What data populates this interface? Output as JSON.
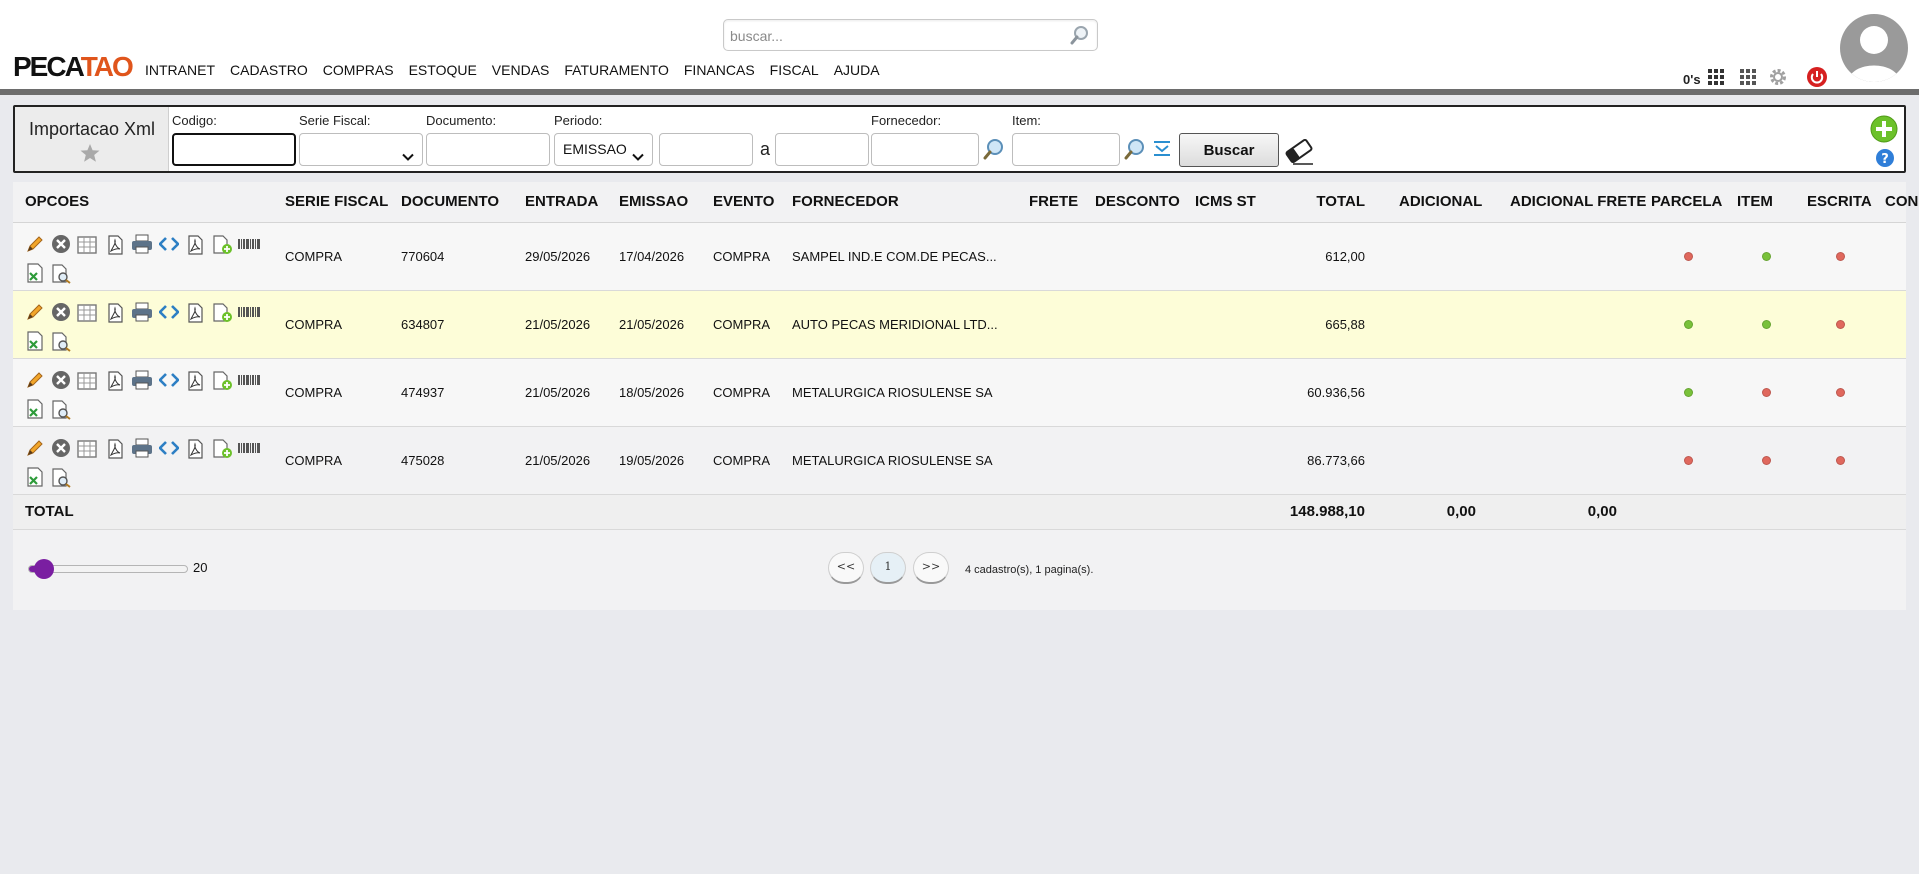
{
  "header": {
    "search_placeholder": "buscar...",
    "logo": {
      "part1": "PECA",
      "part2": "TAO"
    },
    "nav": [
      "INTRANET",
      "CADASTRO",
      "COMPRAS",
      "ESTOQUE",
      "VENDAS",
      "FATURAMENTO",
      "FINANCAS",
      "FISCAL",
      "AJUDA"
    ],
    "status_counter": "0's",
    "icons": [
      "grid-icon",
      "apps-icon",
      "gear-icon",
      "power-icon"
    ]
  },
  "filters": {
    "title": "Importacao Xml",
    "codigo_label": "Codigo:",
    "codigo_value": "",
    "serie_label": "Serie Fiscal:",
    "serie_value": "",
    "documento_label": "Documento:",
    "documento_value": "",
    "periodo_label": "Periodo:",
    "periodo_value": "EMISSAO",
    "periodo_from": "",
    "range_sep": "a",
    "periodo_to": "",
    "fornecedor_label": "Fornecedor:",
    "fornecedor_value": "",
    "item_label": "Item:",
    "item_value": "",
    "buscar_label": "Buscar"
  },
  "table": {
    "columns": [
      "OPCOES",
      "SERIE FISCAL",
      "DOCUMENTO",
      "ENTRADA",
      "EMISSAO",
      "EVENTO",
      "FORNECEDOR",
      "FRETE",
      "DESCONTO",
      "ICMS ST",
      "TOTAL",
      "ADICIONAL",
      "ADICIONAL FRETE",
      "PARCELA",
      "ITEM",
      "ESCRITA",
      "CONF"
    ],
    "rows": [
      {
        "serie": "COMPRA",
        "documento": "770604",
        "entrada": "29/05/2026",
        "emissao": "17/04/2026",
        "evento": "COMPRA",
        "fornecedor": "SAMPEL IND.E COM.DE PECAS...",
        "frete": "",
        "desconto": "",
        "icms_st": "",
        "total": "612,00",
        "adicional": "",
        "adicional_frete": "",
        "parcela": "red",
        "item": "green",
        "escrita": "red",
        "conf": ""
      },
      {
        "serie": "COMPRA",
        "documento": "634807",
        "entrada": "21/05/2026",
        "emissao": "21/05/2026",
        "evento": "COMPRA",
        "fornecedor": "AUTO PECAS MERIDIONAL LTD...",
        "frete": "",
        "desconto": "",
        "icms_st": "",
        "total": "665,88",
        "adicional": "",
        "adicional_frete": "",
        "parcela": "green",
        "item": "green",
        "escrita": "red",
        "conf": ""
      },
      {
        "serie": "COMPRA",
        "documento": "474937",
        "entrada": "21/05/2026",
        "emissao": "18/05/2026",
        "evento": "COMPRA",
        "fornecedor": "METALURGICA RIOSULENSE SA",
        "frete": "",
        "desconto": "",
        "icms_st": "",
        "total": "60.936,56",
        "adicional": "",
        "adicional_frete": "",
        "parcela": "green",
        "item": "red",
        "escrita": "red",
        "conf": ""
      },
      {
        "serie": "COMPRA",
        "documento": "475028",
        "entrada": "21/05/2026",
        "emissao": "19/05/2026",
        "evento": "COMPRA",
        "fornecedor": "METALURGICA RIOSULENSE SA",
        "frete": "",
        "desconto": "",
        "icms_st": "",
        "total": "86.773,66",
        "adicional": "",
        "adicional_frete": "",
        "parcela": "red",
        "item": "red",
        "escrita": "red",
        "conf": ""
      }
    ],
    "totals": {
      "label": "TOTAL",
      "total": "148.988,10",
      "adicional": "0,00",
      "adicional_frete": "0,00"
    }
  },
  "pagination": {
    "page_size": "20",
    "page_size_fraction": 0.1,
    "prev_label": "<<",
    "current_page": "1",
    "next_label": ">>",
    "info": "4 cadastro(s), 1 pagina(s)."
  },
  "colors": {
    "accent": "#7a1ea1",
    "logo_accent": "#e0551c",
    "status_red": "#e0685d",
    "status_green": "#79c13a",
    "highlight_row": "#fdfdd8",
    "power_icon": "#d62020",
    "add_icon": "#6cc12a",
    "help_icon": "#2f7ed8"
  }
}
